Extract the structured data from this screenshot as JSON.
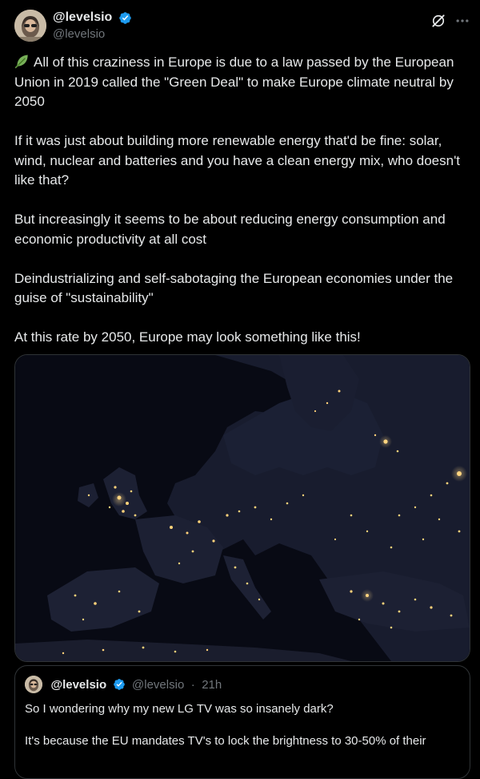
{
  "author": {
    "display_name": "@levelsio",
    "handle": "@levelsio",
    "verified": true
  },
  "tweet": {
    "emoji": "leaf-icon",
    "paragraphs": [
      "All of this craziness in Europe is due to a law passed by the European Union in 2019 called the \"Green Deal\" to make Europe climate neutral by 2050",
      "If it was just about building more renewable energy that'd be fine: solar, wind, nuclear and batteries and you have a clean energy mix, who doesn't like that?",
      "But increasingly it seems to be about reducing energy consumption and economic productivity at all cost",
      "Deindustrializing and self-sabotaging the European economies under the guise of \"sustainability\"",
      "At this rate by 2050, Europe may look something like this!"
    ]
  },
  "actions": {
    "grok_icon": "grok-icon",
    "more_icon": "more-horizontal-icon"
  },
  "media": {
    "kind": "night-satellite-map",
    "region": "Europe"
  },
  "quote": {
    "display_name": "@levelsio",
    "handle": "@levelsio",
    "separator": "·",
    "time": "21h",
    "verified": true,
    "lines": [
      "So I wondering why my new LG TV was so insanely dark?",
      "It's because the EU mandates TV's to lock the brightness to 30-50% of their"
    ]
  },
  "colors": {
    "background": "#000000",
    "text": "#e7e9ea",
    "secondary_text": "#71767b",
    "verified_blue": "#1d9bf0",
    "border": "#2f3336"
  }
}
